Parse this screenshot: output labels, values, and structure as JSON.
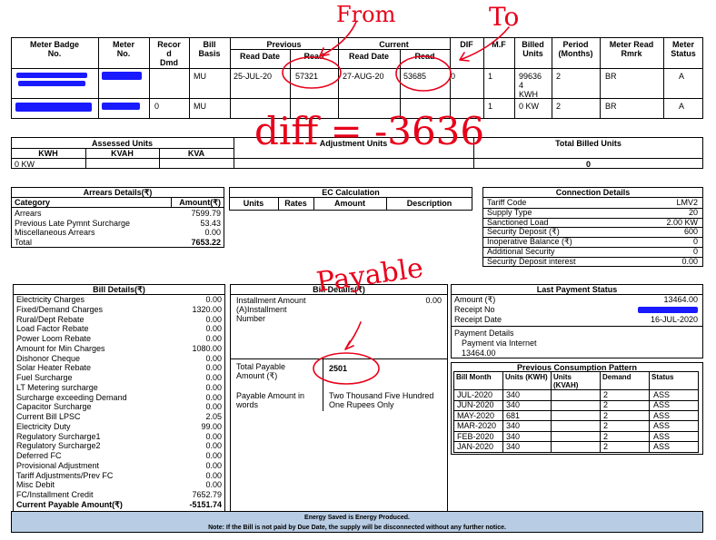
{
  "meter_table": {
    "headers": {
      "badge": [
        "Meter Badge",
        "No."
      ],
      "meter_no": [
        "Meter",
        "No."
      ],
      "record_dmd": [
        "Recor",
        "d",
        "Dmd"
      ],
      "bill_basis": [
        "Bill",
        "Basis"
      ],
      "previous": "Previous",
      "current": "Current",
      "read_date": "Read Date",
      "read": "Read",
      "dif": "DIF",
      "mf": "M.F",
      "billed_units": [
        "Billed",
        "Units"
      ],
      "period": [
        "Period",
        "(Months)"
      ],
      "rmrk": [
        "Meter Read",
        "Rmrk"
      ],
      "status": [
        "Meter",
        "Status"
      ]
    },
    "rows": [
      {
        "record": "",
        "basis": "MU",
        "prev_date": "25-JUL-20",
        "prev_read": "57321",
        "cur_date": "27-AUG-20",
        "cur_read": "53685",
        "dif": "0",
        "mf": "1",
        "units": [
          "99636",
          "4",
          "KWH"
        ],
        "period": "2",
        "rmrk": "BR",
        "status": "A"
      },
      {
        "record": "0",
        "basis": "MU",
        "prev_date": "",
        "prev_read": "",
        "cur_date": "",
        "cur_read": "",
        "dif": "",
        "mf": "1",
        "units": [
          "0 KW"
        ],
        "period": "2",
        "rmrk": "BR",
        "status": "A"
      }
    ]
  },
  "assessed": {
    "title": "Assessed Units",
    "cols": [
      "KWH",
      "KVAH",
      "KVA"
    ],
    "kwh_value": "0 KW",
    "adjustment_title": "Adjustment Units",
    "total_billed_title": "Total Billed Units",
    "total_billed_value": "0"
  },
  "arrears": {
    "title": "Arrears Details(₹)",
    "col_category": "Category",
    "col_amount": "Amount(₹)",
    "rows": [
      {
        "label": "Arrears",
        "value": "7599.79"
      },
      {
        "label": "Previous Late Pymnt Surcharge",
        "value": "53.43"
      },
      {
        "label": "Miscellaneous Arrears",
        "value": "0.00"
      }
    ],
    "total_label": "Total",
    "total_value": "7653.22"
  },
  "ec_calc": {
    "title": "EC Calculation",
    "cols": [
      "Units",
      "Rates",
      "Amount",
      "Description"
    ]
  },
  "connection": {
    "title": "Connection Details",
    "rows": [
      {
        "label": "Tariff Code",
        "value": "LMV2"
      },
      {
        "label": "Supply Type",
        "value": "20"
      },
      {
        "label": "Sanctioned Load",
        "value": "2.00 KW"
      },
      {
        "label": "Security Deposit (₹)",
        "value": "600"
      },
      {
        "label": "Inoperative Balance (₹)",
        "value": "0"
      },
      {
        "label": "Additional Security",
        "value": "0"
      },
      {
        "label": "Security Deposit interest",
        "value": "0.00"
      }
    ]
  },
  "bill_details": {
    "title": "Bill Details(₹)",
    "rows": [
      {
        "label": "Electricity Charges",
        "value": "0.00"
      },
      {
        "label": "Fixed/Demand Charges",
        "value": "1320.00"
      },
      {
        "label": "Rural/Dept Rebate",
        "value": "0.00"
      },
      {
        "label": "Load Factor Rebate",
        "value": "0.00"
      },
      {
        "label": "Power Loom Rebate",
        "value": "0.00"
      },
      {
        "label": "Amount for Min Charges",
        "value": "1080.00"
      },
      {
        "label": "Dishonor Cheque",
        "value": "0.00"
      },
      {
        "label": "Solar Heater Rebate",
        "value": "0.00"
      },
      {
        "label": "Fuel Surcharge",
        "value": "0.00"
      },
      {
        "label": "LT Metering surcharge",
        "value": "0.00"
      },
      {
        "label": "Surcharge exceeding Demand",
        "value": "0.00"
      },
      {
        "label": "Capacitor Surcharge",
        "value": "0.00"
      },
      {
        "label": "Current Bill LPSC",
        "value": "2.05"
      },
      {
        "label": "Electricity Duty",
        "value": "99.00"
      },
      {
        "label": "Regulatory Surcharge1",
        "value": "0.00"
      },
      {
        "label": "Regulatory Surcharge2",
        "value": "0.00"
      },
      {
        "label": "Deferred FC",
        "value": "0.00"
      },
      {
        "label": "Provisional Adjustment",
        "value": "0.00"
      },
      {
        "label": "Tariff Adjustments/Prev FC",
        "value": "0.00"
      },
      {
        "label": "Misc Debit",
        "value": "0.00"
      },
      {
        "label": "FC/Installment Credit",
        "value": "7652.79"
      }
    ],
    "current_payable_label": "Current Payable Amount(₹)",
    "current_payable_value": "-5151.74"
  },
  "bill_details_mid": {
    "title": "Bill Details(₹)",
    "installment_label": [
      "Installment Amount",
      "(A)Installment",
      "Number"
    ],
    "installment_value": "0.00",
    "total_payable_label": [
      "Total Payable",
      "Amount (₹)"
    ],
    "total_payable_value": "2501",
    "words_label": [
      "Payable Amount in",
      "words"
    ],
    "words_value": [
      "Two Thousand Five Hundred",
      "One Rupees Only"
    ]
  },
  "last_payment": {
    "title": "Last Payment Status",
    "amount_label": "Amount (₹)",
    "amount_value": "13464.00",
    "receipt_label": "Receipt No",
    "date_label": "Receipt Date",
    "date_value": "16-JUL-2020",
    "details_label": "Payment Details",
    "via": "Payment via Internet",
    "details_amount": "13464.00"
  },
  "consumption": {
    "title": "Previous Consumption Pattern",
    "headers": {
      "month": "Bill Month",
      "kwh": "Units (KWH)",
      "kvah": [
        "Units",
        "(KVAH)"
      ],
      "demand": "Demand",
      "status": "Status"
    },
    "rows": [
      {
        "month": "JUL-2020",
        "kwh": "340",
        "kvah": "",
        "demand": "2",
        "status": "ASS"
      },
      {
        "month": "JUN-2020",
        "kwh": "340",
        "kvah": "",
        "demand": "2",
        "status": "ASS"
      },
      {
        "month": "MAY-2020",
        "kwh": "681",
        "kvah": "",
        "demand": "2",
        "status": "ASS"
      },
      {
        "month": "MAR-2020",
        "kwh": "340",
        "kvah": "",
        "demand": "2",
        "status": "ASS"
      },
      {
        "month": "FEB-2020",
        "kwh": "340",
        "kvah": "",
        "demand": "2",
        "status": "ASS"
      },
      {
        "month": "JAN-2020",
        "kwh": "340",
        "kvah": "",
        "demand": "2",
        "status": "ASS"
      }
    ]
  },
  "footer": {
    "line1": "Energy Saved is Energy Produced.",
    "line2": "Note: If the Bill is not paid by Due Date, the supply will be disconnected without any further notice."
  },
  "annotations": {
    "from": "From",
    "to": "To",
    "diff": "diff = -3636",
    "payable": "Payable",
    "color": "#e8001a"
  },
  "colors": {
    "redaction": "#1a1aff",
    "footer_bg": "#b8cce4"
  }
}
